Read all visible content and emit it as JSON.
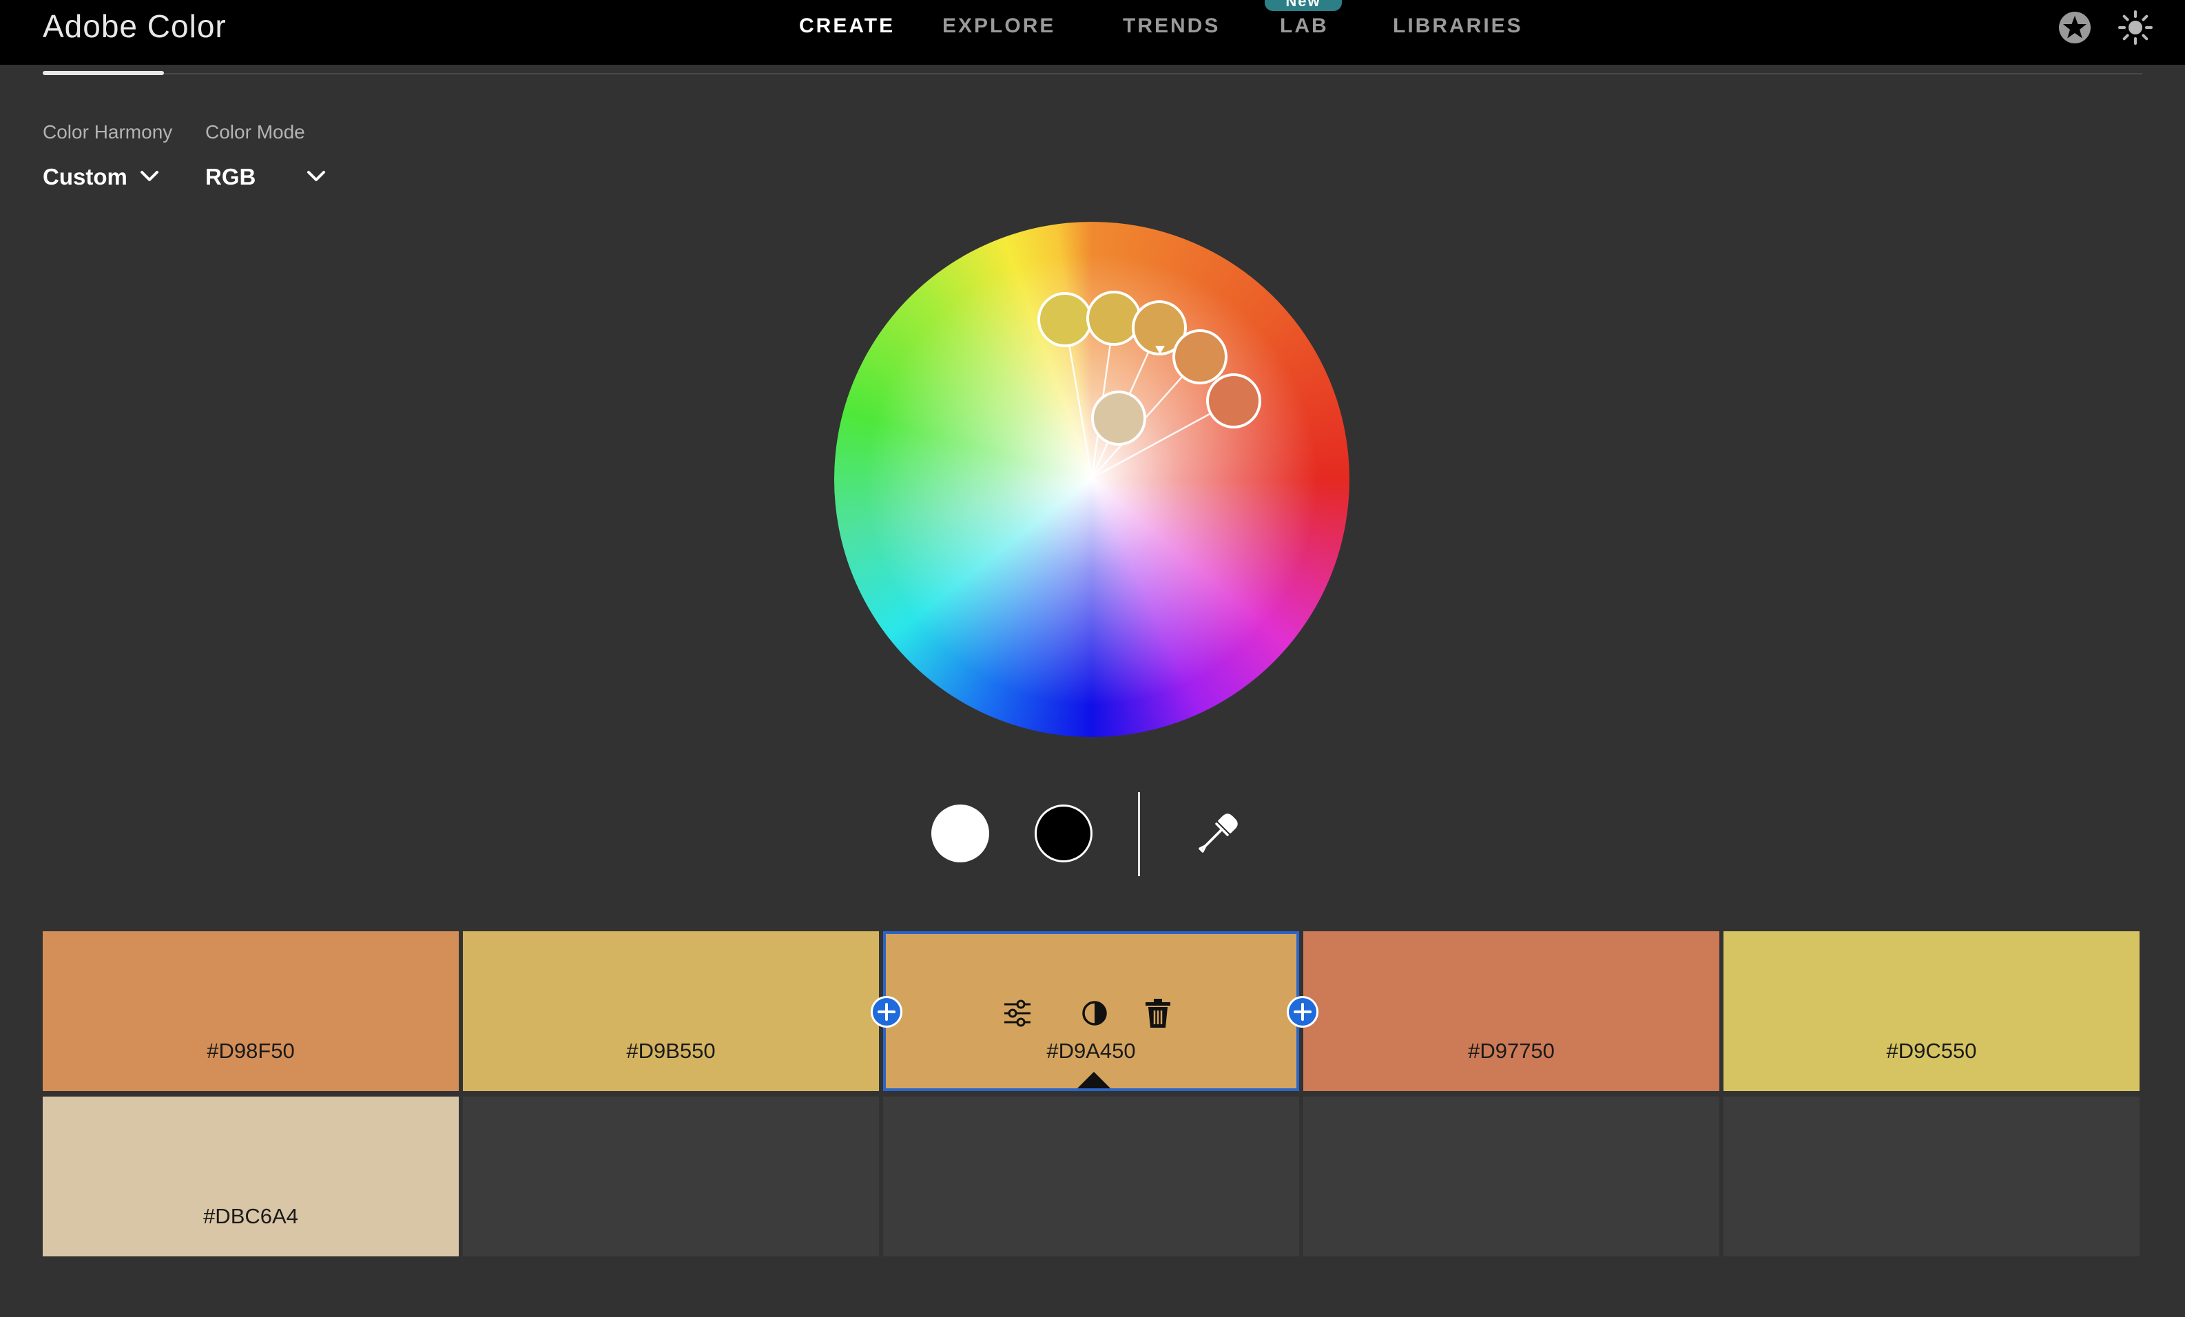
{
  "app": {
    "title": "Adobe Color"
  },
  "nav": {
    "items": [
      {
        "label": "CREATE",
        "active": true
      },
      {
        "label": "EXPLORE",
        "active": false
      },
      {
        "label": "TRENDS",
        "active": false
      },
      {
        "label": "LAB",
        "active": false
      },
      {
        "label": "LIBRARIES",
        "active": false
      }
    ],
    "lab_badge": "New",
    "icons": [
      "star-icon",
      "brightness-icon"
    ]
  },
  "controls": {
    "harmony": {
      "label": "Color Harmony",
      "value": "Custom"
    },
    "mode": {
      "label": "Color Mode",
      "value": "RGB"
    }
  },
  "tools": [
    "white-color",
    "black-color",
    "eyedropper-icon"
  ],
  "palette": {
    "selected_index": 2,
    "swatches": [
      {
        "hex": "#D98F50",
        "color": "#D48F58"
      },
      {
        "hex": "#D9B550",
        "color": "#D4B460"
      },
      {
        "hex": "#D9A450",
        "color": "#D4A45E"
      },
      {
        "hex": "#D97750",
        "color": "#CD7A57"
      },
      {
        "hex": "#D9C550",
        "color": "#D6C462"
      },
      {
        "hex": "#DBC6A4",
        "color": "#D9C6A6"
      }
    ],
    "swatch_tool_icons": [
      "sliders-icon",
      "contrast-icon",
      "trash-icon"
    ]
  },
  "accent": "#2B65C8"
}
